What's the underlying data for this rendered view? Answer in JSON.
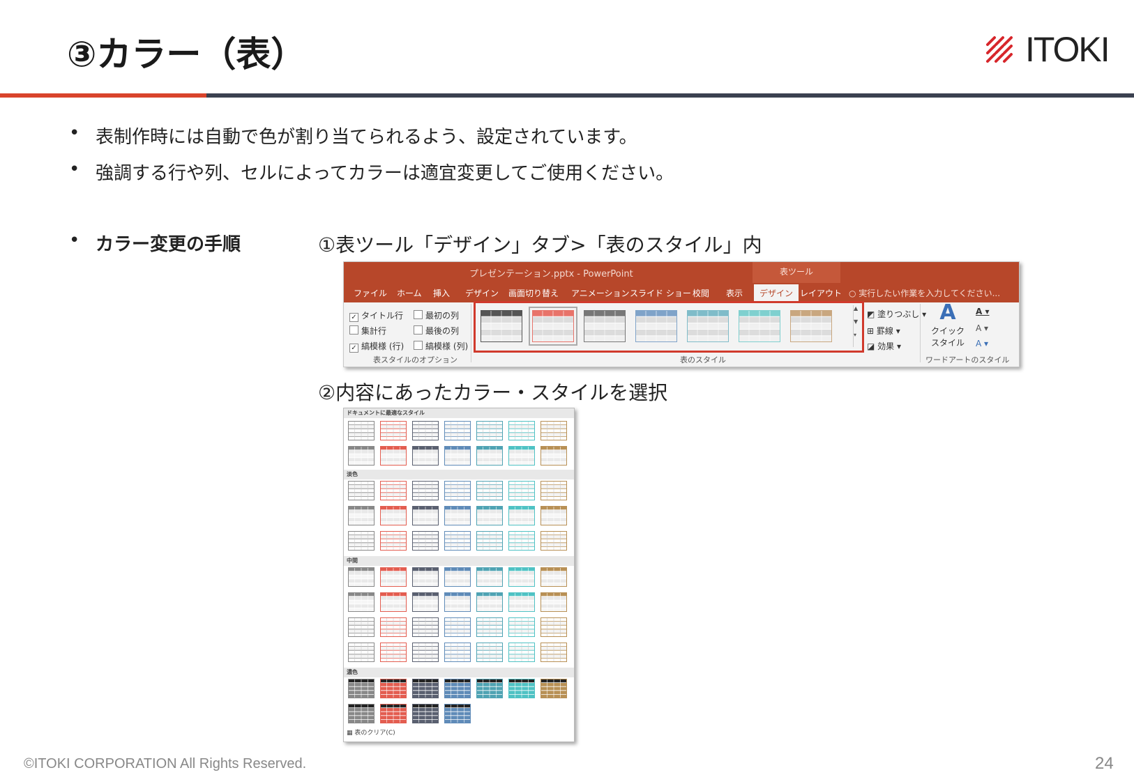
{
  "slide": {
    "title": "③カラー（表）",
    "logo_text": "ITOKI",
    "bullets": [
      "表制作時には自動で色が割り当てられるよう、設定されています。",
      "強調する行や列、セルによってカラーは適宜変更してご使用ください。"
    ],
    "procedure_label": "カラー変更の手順",
    "step1": "①表ツール「デザイン」タブ>「表のスタイル」内",
    "step2": "②内容にあったカラー・スタイルを選択",
    "footer": "©ITOKI CORPORATION All Rights Reserved.",
    "page_number": "24"
  },
  "ribbon": {
    "window_title": "プレゼンテーション.pptx - PowerPoint",
    "context_tab": "表ツール",
    "tabs": [
      "ファイル",
      "ホーム",
      "挿入",
      "デザイン",
      "画面切り替え",
      "アニメーション",
      "スライド ショー",
      "校閲",
      "表示",
      "デザイン",
      "レイアウト"
    ],
    "search": "実行したい作業を入力してください...",
    "options": {
      "header_row": "タイトル行",
      "total_row": "集計行",
      "banded_rows": "縞模様 (行)",
      "first_column": "最初の列",
      "last_column": "最後の列",
      "banded_columns": "縞模様 (列)"
    },
    "group_options": "表スタイルのオプション",
    "group_styles": "表のスタイル",
    "group_wordart": "ワードアートのスタイル",
    "shading": "塗りつぶし",
    "borders": "罫線",
    "effects": "効果",
    "quick_style_1": "クイック",
    "quick_style_2": "スタイル",
    "style_colors": [
      "#555555",
      "#e8736a",
      "#777777",
      "#7fa3c9",
      "#7fbcc9",
      "#7fd0cf",
      "#c9a77f"
    ]
  },
  "gallery": {
    "sections": [
      "ドキュメントに最適なスタイル",
      "淡色",
      "中間",
      "濃色"
    ],
    "clear_label": "表のクリア(C)",
    "colors": [
      "#888888",
      "#e35d50",
      "#5a6070",
      "#5f8bb8",
      "#4fa3b3",
      "#4fc2c4",
      "#b89055"
    ]
  }
}
